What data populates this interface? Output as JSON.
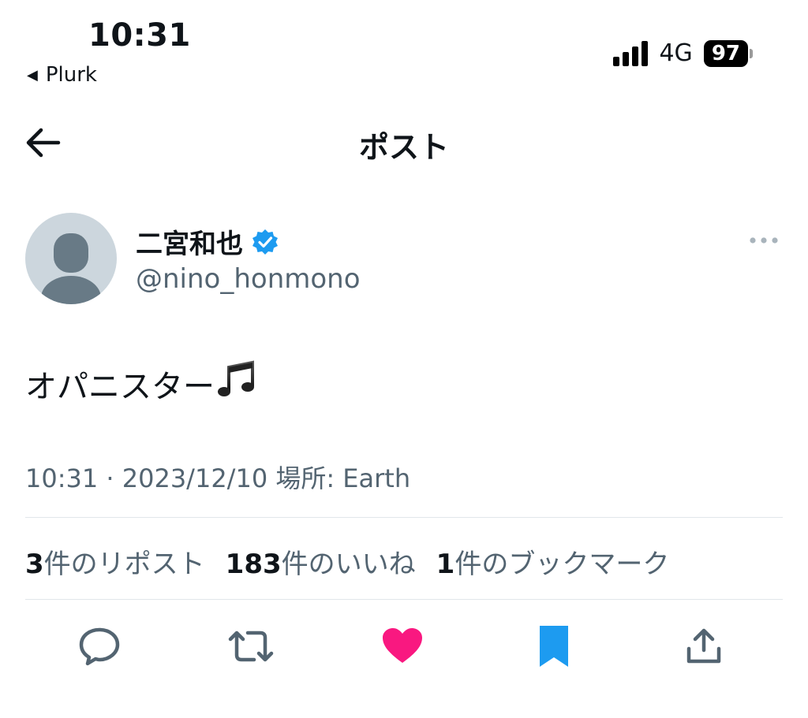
{
  "status_bar": {
    "time": "10:31",
    "back_app": "Plurk",
    "network": "4G",
    "battery": "97"
  },
  "header": {
    "title": "ポスト"
  },
  "author": {
    "display_name": "二宮和也",
    "handle": "@nino_honmono"
  },
  "post": {
    "text": "オパニスター",
    "meta": "10:31 · 2023/12/10 場所: Earth"
  },
  "stats": [
    {
      "count": "3",
      "label": "件のリポスト"
    },
    {
      "count": "183",
      "label": "件のいいね"
    },
    {
      "count": "1",
      "label": "件のブックマーク"
    }
  ],
  "colors": {
    "like": "#f91880",
    "bookmark": "#1d9bf0",
    "verified": "#1d9bf0",
    "secondary_text": "#536471"
  },
  "icons": [
    "signal-icon",
    "battery-icon",
    "back-arrow-icon",
    "verified-badge-icon",
    "more-icon",
    "music-notes-icon",
    "reply-icon",
    "repost-icon",
    "like-icon",
    "bookmark-icon",
    "share-icon"
  ]
}
